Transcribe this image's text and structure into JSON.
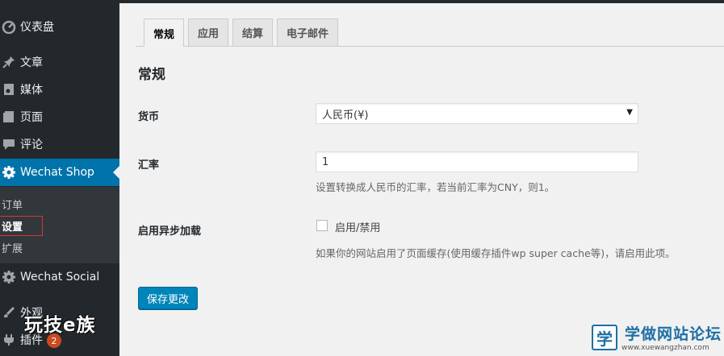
{
  "sidebar": {
    "items": [
      {
        "label": "仪表盘",
        "icon": "dashboard-icon"
      },
      {
        "label": "文章",
        "icon": "pushpin-icon"
      },
      {
        "label": "媒体",
        "icon": "media-icon"
      },
      {
        "label": "页面",
        "icon": "page-icon"
      },
      {
        "label": "评论",
        "icon": "comment-icon"
      },
      {
        "label": "Wechat Shop",
        "icon": "gear-icon",
        "active": true
      },
      {
        "label": "Wechat Social",
        "icon": "gear-icon"
      },
      {
        "label": "外观",
        "icon": "brush-icon"
      },
      {
        "label": "插件",
        "icon": "plugin-icon",
        "badge": "2"
      }
    ],
    "submenu": [
      {
        "label": "订单"
      },
      {
        "label": "设置",
        "current": true
      },
      {
        "label": "扩展"
      }
    ],
    "watermark": "玩技e族"
  },
  "tabs": [
    {
      "label": "常规",
      "active": true
    },
    {
      "label": "应用"
    },
    {
      "label": "结算"
    },
    {
      "label": "电子邮件"
    }
  ],
  "form": {
    "section_title": "常规",
    "currency": {
      "label": "货币",
      "value": "人民币(¥)"
    },
    "rate": {
      "label": "汇率",
      "value": "1",
      "description": "设置转换成人民币的汇率，若当前汇率为CNY，则1。"
    },
    "async": {
      "label": "启用异步加载",
      "checkbox_label": "启用/禁用",
      "checked": false,
      "description": "如果你的网站启用了页面缓存(使用缓存插件wp super cache等)，请启用此项。"
    },
    "save_label": "保存更改"
  },
  "watermark_logo": {
    "glyph": "学",
    "title": "学做网站论坛",
    "url": "www.xuewangzhan.com"
  },
  "colors": {
    "sidebar_bg": "#23282d",
    "active_menu": "#0073aa",
    "primary_button": "#0085ba",
    "badge": "#ca4a1f"
  }
}
